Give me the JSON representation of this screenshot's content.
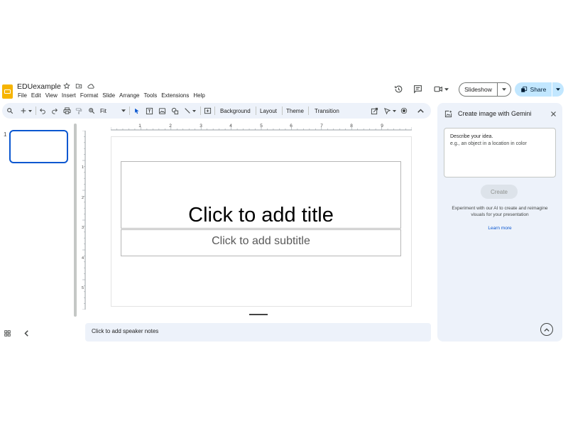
{
  "doc": {
    "title": "EDUexample",
    "menus": [
      "File",
      "Edit",
      "View",
      "Insert",
      "Format",
      "Slide",
      "Arrange",
      "Tools",
      "Extensions",
      "Help"
    ]
  },
  "header": {
    "slideshow_label": "Slideshow",
    "share_label": "Share"
  },
  "toolbar": {
    "zoom": "Fit",
    "background_label": "Background",
    "layout_label": "Layout",
    "theme_label": "Theme",
    "transition_label": "Transition"
  },
  "filmstrip": {
    "slides": [
      {
        "number": "1"
      }
    ]
  },
  "ruler": {
    "horizontal_labels": [
      "1",
      "2",
      "3",
      "4",
      "5",
      "6",
      "7",
      "8",
      "9"
    ],
    "vertical_labels": [
      "1",
      "2",
      "3",
      "4",
      "5"
    ]
  },
  "slide": {
    "title_placeholder": "Click to add title",
    "subtitle_placeholder": "Click to add subtitle"
  },
  "notes": {
    "placeholder": "Click to add speaker notes"
  },
  "gemini_panel": {
    "title": "Create image with Gemini",
    "prompt_label": "Describe your idea.",
    "prompt_placeholder": "e.g., an object in a location in color",
    "create_label": "Create",
    "description": "Experiment with our AI to create and reimagine visuals for your presentation",
    "learn_more": "Learn more"
  },
  "colors": {
    "accent": "#0b57d0",
    "logo": "#f6b400",
    "toolbar_bg": "#edf2fa",
    "share_bg": "#c2e7ff"
  },
  "icons": {
    "title_icons": [
      "star-icon",
      "folder-move-icon",
      "cloud-status-icon"
    ],
    "header_icons": [
      "version-history-icon",
      "comments-icon",
      "meet-video-icon"
    ],
    "toolbar_icons": [
      "search-menus-icon",
      "new-slide-icon",
      "undo-icon",
      "redo-icon",
      "print-icon",
      "paint-format-icon",
      "zoom-icon",
      "select-icon",
      "text-box-icon",
      "image-icon",
      "shape-icon",
      "line-icon",
      "comment-add-icon",
      "motion-icon",
      "pen-icon",
      "record-icon",
      "collapse-toolbar-icon"
    ],
    "panel_icons": [
      "image-create-icon",
      "close-icon",
      "chevron-up-icon"
    ],
    "bottom_icons": [
      "grid-view-icon",
      "collapse-filmstrip-icon"
    ]
  }
}
